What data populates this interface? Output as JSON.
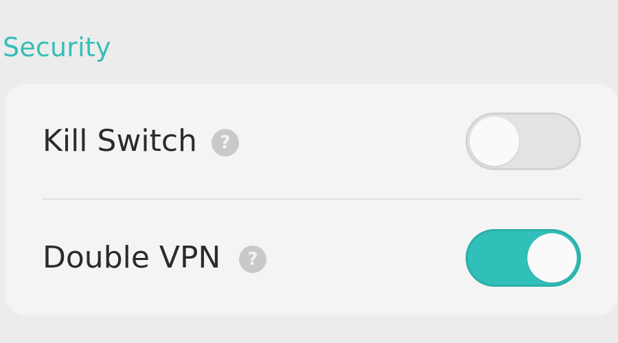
{
  "section": {
    "title": "Security"
  },
  "colors": {
    "accent": "#35beb8",
    "toggle_on": "#31bfba",
    "toggle_off": "#e3e3e3"
  },
  "settings": [
    {
      "label": "Kill Switch",
      "help_icon": "question-mark-icon",
      "help_glyph": "?",
      "enabled": false
    },
    {
      "label": "Double VPN",
      "help_icon": "question-mark-icon",
      "help_glyph": "?",
      "enabled": true
    }
  ]
}
